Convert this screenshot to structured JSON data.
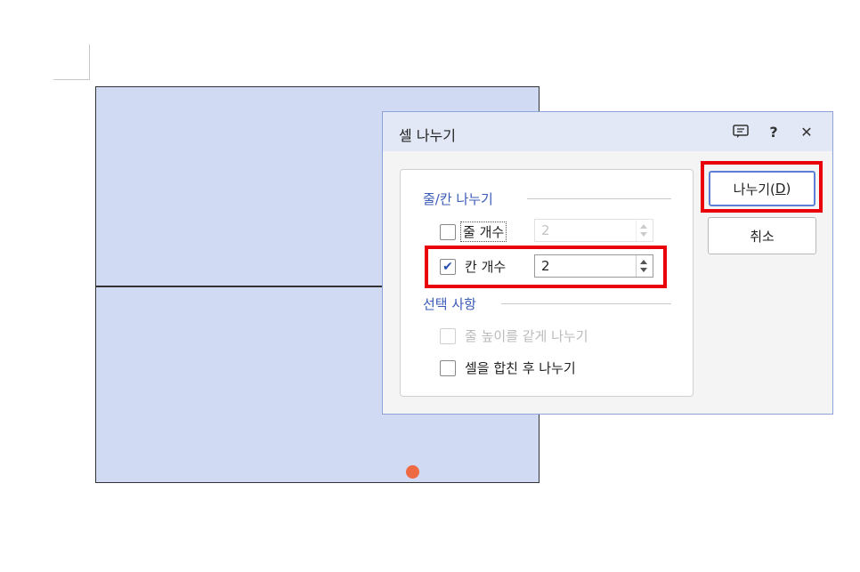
{
  "dialog": {
    "title": "셀 나누기",
    "icons": {
      "comment": "comment-icon",
      "help": "?",
      "close": "✕"
    },
    "section_split": "줄/칸 나누기",
    "rows": {
      "label": "줄 개수",
      "value": "2",
      "checked": false,
      "enabled": false
    },
    "cols": {
      "label": "칸 개수",
      "value": "2",
      "checked": true,
      "enabled": true
    },
    "section_options": "선택 사항",
    "opt_equal_height": {
      "label": "줄 높이를 같게 나누기",
      "checked": false,
      "enabled": false
    },
    "opt_merge_first": {
      "label": "셀을 합친 후 나누기",
      "checked": false,
      "enabled": true
    },
    "btn_split": {
      "text": "나누기(",
      "mnemonic": "D",
      "close": ")"
    },
    "btn_cancel": "취소"
  },
  "colors": {
    "highlight": "#e8000b",
    "table_fill": "#d1daf3",
    "cursor": "#ee6a43",
    "accent": "#3a5bb8"
  }
}
